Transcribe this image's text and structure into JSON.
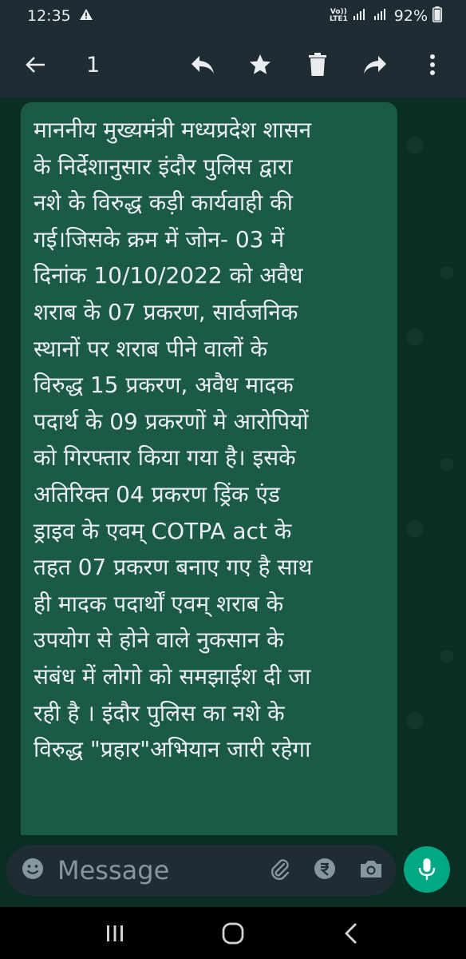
{
  "status_bar": {
    "time": "12:35",
    "lte_top": "Vo))",
    "lte_bottom": "LTE1",
    "battery": "92%"
  },
  "toolbar": {
    "selected_count": "1"
  },
  "message": {
    "text": "माननीय मुख्यमंत्री मध्यप्रदेश शासन\nके निर्देशानुसार इंदौर पुलिस द्वारा\nनशे के विरुद्ध कड़ी कार्यवाही की\nगई।जिसके क्रम में जोन- 03 में\nदिनांक 10/10/2022 को अवैध\nशराब के 07 प्रकरण, सार्वजनिक\nस्थानों पर शराब पीने वालों के\nविरुद्ध 15 प्रकरण, अवैध मादक\nपदार्थ के 09 प्रकरणों मे आरोपियों\nको गिरफ्तार किया गया है। इसके\nअतिरिक्त 04 प्रकरण ड्रिंक एंड\nड्राइव के एवम् COTPA act के\nतहत 07 प्रकरण बनाए गए है साथ\nही मादक पदार्थों एवम् शराब के\nउपयोग से होने वाले नुकसान के\nसंबंध में लोगो को समझाईश दी जा\nरही है । इंदौर पुलिस का नशे के\nविरुद्ध \"प्रहार\"अभियान जारी रहेगा"
  },
  "composer": {
    "placeholder": "Message"
  },
  "colors": {
    "app_bar": "#1f2c33",
    "chat_bg": "#0b2e24",
    "bubble": "#1b5a47",
    "accent": "#00a884"
  }
}
